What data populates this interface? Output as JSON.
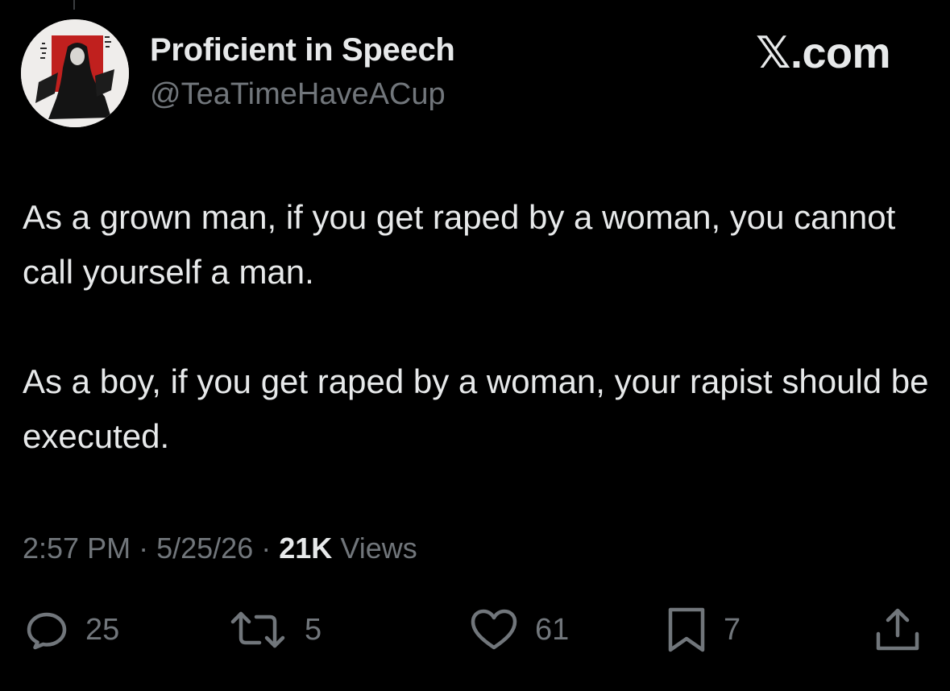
{
  "author": {
    "display_name": "Proficient in Speech",
    "handle": "@TeaTimeHaveACup"
  },
  "watermark": {
    "x_glyph": "𝕏",
    "domain": ".com"
  },
  "tweet": {
    "paragraphs": [
      "As a grown man, if you get raped by a woman, you cannot call yourself a man.",
      "As a boy, if you get raped by a woman, your rapist should be executed."
    ]
  },
  "meta": {
    "time": "2:57 PM",
    "separator": "·",
    "date": "5/25/26",
    "views_count": "21K",
    "views_label": "Views"
  },
  "actions": {
    "replies": "25",
    "reposts": "5",
    "likes": "61",
    "bookmarks": "7"
  },
  "colors": {
    "background": "#000000",
    "primary_text": "#e7e9ea",
    "secondary_text": "#71767b"
  }
}
